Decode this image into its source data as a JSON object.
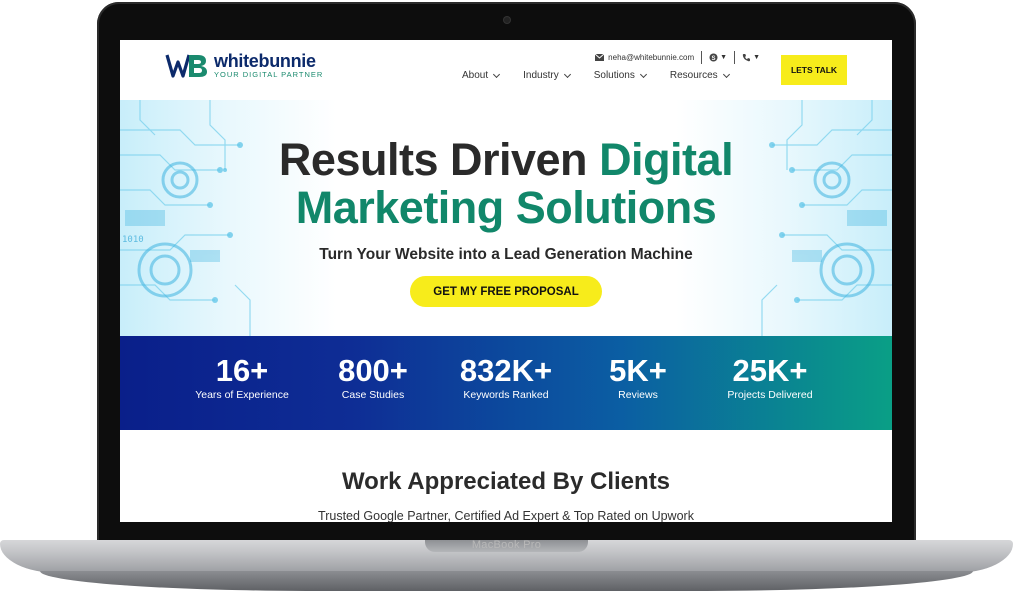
{
  "device": {
    "brand_label": "MacBook Pro"
  },
  "header": {
    "logo_name": "whitebunnie",
    "logo_tagline": "YOUR DIGITAL PARTNER",
    "email": "neha@whitebunnie.com",
    "cta_label": "LETS TALK",
    "nav": [
      {
        "label": "About"
      },
      {
        "label": "Industry"
      },
      {
        "label": "Solutions"
      },
      {
        "label": "Resources"
      }
    ]
  },
  "hero": {
    "title_dark": "Results Driven",
    "title_green_1": "Digital",
    "title_green_2": "Marketing Solutions",
    "subtitle": "Turn Your Website into a Lead Generation Machine",
    "cta_label": "GET MY FREE PROPOSAL"
  },
  "stats": [
    {
      "value": "16+",
      "label": "Years of Experience"
    },
    {
      "value": "800+",
      "label": "Case Studies"
    },
    {
      "value": "832K+",
      "label": "Keywords Ranked"
    },
    {
      "value": "5K+",
      "label": "Reviews"
    },
    {
      "value": "25K+",
      "label": "Projects Delivered"
    }
  ],
  "clients": {
    "title": "Work Appreciated By Clients",
    "subtitle": "Trusted Google Partner, Certified Ad Expert & Top Rated on Upwork"
  },
  "colors": {
    "accent_yellow": "#f7ec1b",
    "brand_green": "#11876a",
    "brand_navy": "#0c2a6b"
  },
  "icons": [
    "mail-icon",
    "skype-icon",
    "phone-icon",
    "chevron-down-icon"
  ]
}
